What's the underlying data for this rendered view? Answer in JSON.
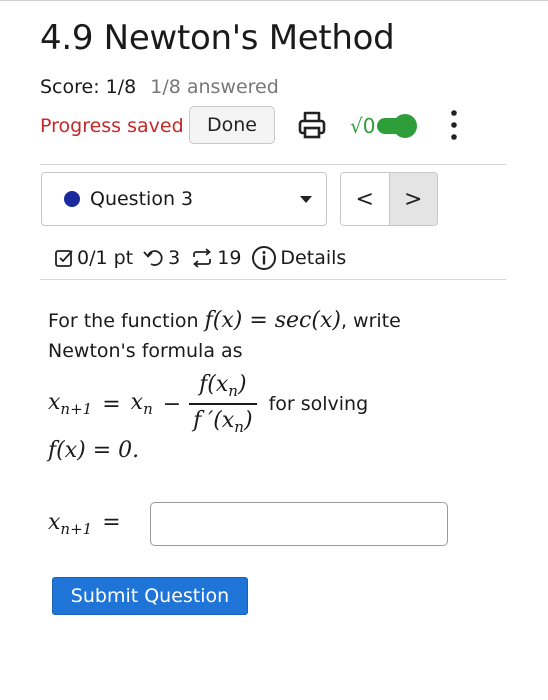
{
  "assignment": {
    "title": "4.9 Newton's Method",
    "score": "Score: 1/8",
    "answered": "1/8 answered"
  },
  "toolbar": {
    "progress_text": "Progress saved",
    "done_label": "Done",
    "math_toggle_label": "√0",
    "math_toggle_on": true,
    "accent_color": "#2e9e3a",
    "icons": [
      "printer-icon",
      "kebab-menu-icon"
    ]
  },
  "question_nav": {
    "selected": "Question 3",
    "status_color": "#1a2a9c",
    "prev_glyph": "<",
    "next_glyph": ">"
  },
  "meta": {
    "points": "0/1 pt",
    "retries": "3",
    "attempts": "19",
    "details_label": "Details"
  },
  "question": {
    "intro": "For the function",
    "func_lhs": "f(x) = sec(x)",
    "intro_tail": ", write Newton's formula as",
    "formula_lhs": "x",
    "formula_lhs_sub": "n+1",
    "formula_eq": "=",
    "formula_x": "x",
    "formula_x_sub": "n",
    "formula_minus": "−",
    "frac_num_f": "f(x",
    "frac_num_sub": "n",
    "frac_num_close": ")",
    "frac_den_f": "f ′(x",
    "frac_den_sub": "n",
    "frac_den_close": ")",
    "for_solving": "for solving",
    "equation": "f(x) = 0.",
    "answer_lhs": "x",
    "answer_lhs_sub": "n+1",
    "answer_eq": "=",
    "answer_value": ""
  },
  "actions": {
    "submit_label": "Submit Question",
    "submit_color": "#1f74d8",
    "error_color": "#c62828"
  }
}
